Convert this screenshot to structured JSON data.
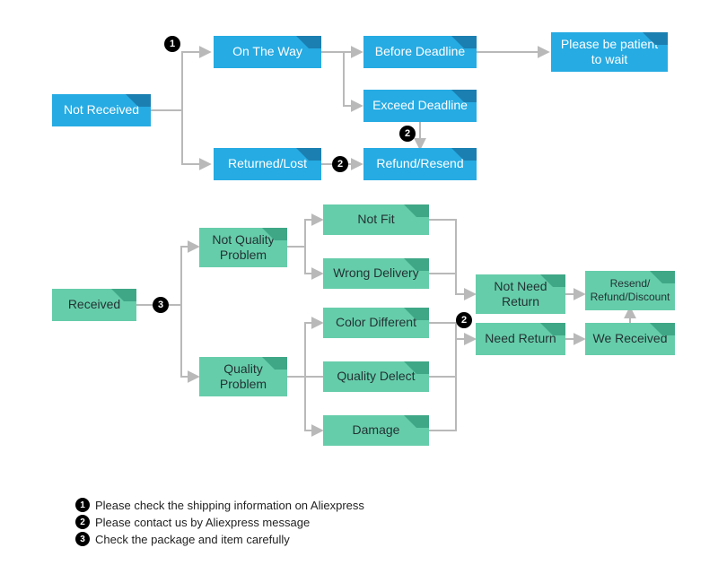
{
  "colors": {
    "blue": "#26abe3",
    "green": "#66cdaa",
    "arrow": "#b9b9b9"
  },
  "nodes": {
    "nr": {
      "label": "Not Received"
    },
    "otw": {
      "label": "On The Way"
    },
    "rl": {
      "label": "Returned/Lost"
    },
    "bd": {
      "label": "Before Deadline"
    },
    "ed": {
      "label": "Exceed Deadline"
    },
    "rr": {
      "label": "Refund/Resend"
    },
    "wait": {
      "label": "Please be patient to wait"
    },
    "rec": {
      "label": "Received"
    },
    "nqp": {
      "label": "Not Quality Problem"
    },
    "qp": {
      "label": "Quality Problem"
    },
    "nf": {
      "label": "Not Fit"
    },
    "wd": {
      "label": "Wrong Delivery"
    },
    "cd": {
      "label": "Color Different"
    },
    "qd": {
      "label": "Quality Delect"
    },
    "dmg": {
      "label": "Damage"
    },
    "nnr": {
      "label": "Not Need Return"
    },
    "ndr": {
      "label": "Need Return"
    },
    "wr": {
      "label": "We Received"
    },
    "out": {
      "label": "Resend/\nRefund/Discount"
    }
  },
  "badges": {
    "b1": "1",
    "b2": "2",
    "b3": "2",
    "b4": "3",
    "b5": "2"
  },
  "legend": {
    "l1": "Please check the shipping information on Aliexpress",
    "l2": "Please contact us by Aliexpress message",
    "l3": "Check the package and item carefully"
  }
}
